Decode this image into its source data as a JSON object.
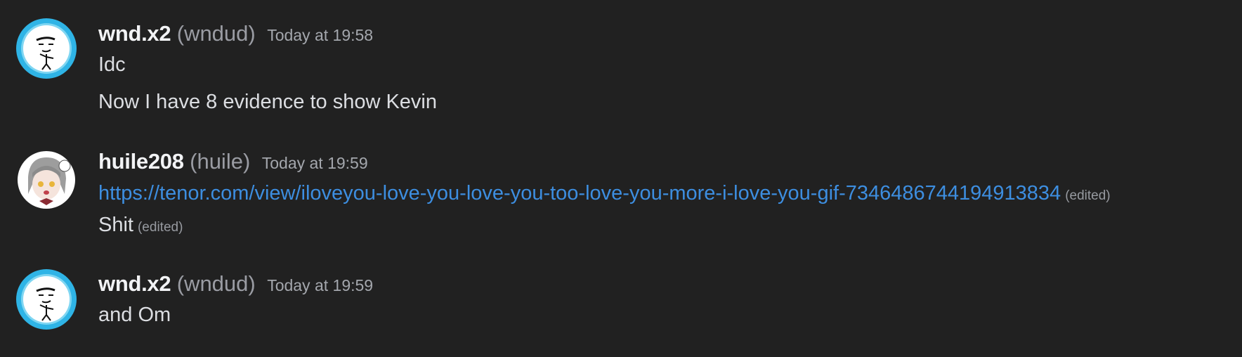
{
  "messages": [
    {
      "display_name": "wnd.x2",
      "username": "(wndud)",
      "timestamp": "Today at 19:58",
      "lines": [
        {
          "text": "Idc"
        },
        {
          "text": "Now I have 8 evidence to show Kevin"
        }
      ]
    },
    {
      "display_name": "huile208",
      "username": "(huile)",
      "timestamp": "Today at 19:59",
      "lines": [
        {
          "link": "https://tenor.com/view/iloveyou-love-you-love-you-too-love-you-more-i-love-you-gif-7346486744194913834",
          "edited": "(edited)"
        },
        {
          "text": "Shit",
          "edited": "(edited)"
        }
      ]
    },
    {
      "display_name": "wnd.x2",
      "username": "(wndud)",
      "timestamp": "Today at 19:59",
      "lines": [
        {
          "text": "and Om"
        }
      ]
    }
  ],
  "icons": {
    "avatar_1": "avatar-stickman-icon",
    "avatar_2": "avatar-anime-girl-icon",
    "avatar_3": "avatar-stickman-icon"
  },
  "colors": {
    "background": "#212121",
    "display_name": "#f2f3f5",
    "username": "#9a9ca3",
    "link": "#3d8ee0"
  }
}
